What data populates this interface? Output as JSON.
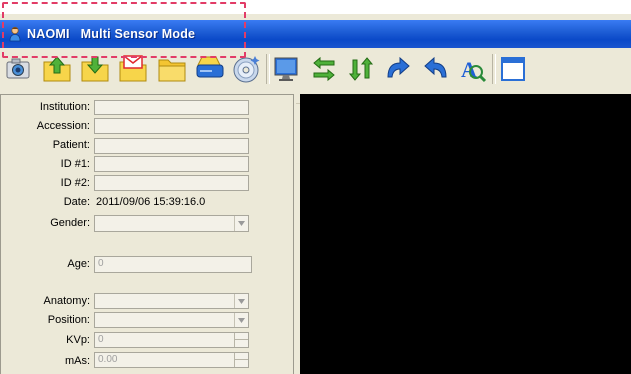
{
  "window": {
    "title": "NAOMI   Multi Sensor Mode"
  },
  "toolbar": {
    "buttons": [
      {
        "name": "camera-icon",
        "color": "#8a8f9a"
      },
      {
        "name": "folder-upload-icon",
        "color": "#4fb13a"
      },
      {
        "name": "folder-download-icon",
        "color": "#4fb13a"
      },
      {
        "name": "envelope-icon",
        "color": "#e1282e"
      },
      {
        "name": "folder-icon",
        "color": "#f4c531"
      },
      {
        "name": "disk-drive-icon",
        "color": "#2a6fd6"
      },
      {
        "name": "cd-burn-icon",
        "color": "#5a8fd6"
      },
      {
        "name": "monitor-icon",
        "color": "#2a6fd6"
      },
      {
        "name": "swap-horizontal-icon",
        "color": "#4fb13a"
      },
      {
        "name": "swap-vertical-icon",
        "color": "#4fb13a"
      },
      {
        "name": "rotate-right-icon",
        "color": "#2a6fd6"
      },
      {
        "name": "rotate-left-icon",
        "color": "#2a6fd6"
      },
      {
        "name": "text-zoom-icon",
        "color": "#1f5fd6"
      },
      {
        "name": "window-icon",
        "color": "#2a6fd6"
      }
    ]
  },
  "form": {
    "institution": {
      "label": "Institution:",
      "value": ""
    },
    "accession": {
      "label": "Accession:",
      "value": ""
    },
    "patient": {
      "label": "Patient:",
      "value": ""
    },
    "id1": {
      "label": "ID #1:",
      "value": ""
    },
    "id2": {
      "label": "ID #2:",
      "value": ""
    },
    "date": {
      "label": "Date:",
      "value": "2011/09/06 15:39:16.0"
    },
    "gender": {
      "label": "Gender:",
      "value": ""
    },
    "age": {
      "label": "Age:",
      "value": "0"
    },
    "anatomy": {
      "label": "Anatomy:",
      "value": ""
    },
    "position": {
      "label": "Position:",
      "value": ""
    },
    "kvp": {
      "label": "KVp:",
      "value": "0"
    },
    "mas": {
      "label": "mAs:",
      "value": "0.00"
    }
  },
  "colors": {
    "titlebar": "#1f5fd6",
    "highlight": "#e23c67",
    "viewer": "#000000"
  }
}
